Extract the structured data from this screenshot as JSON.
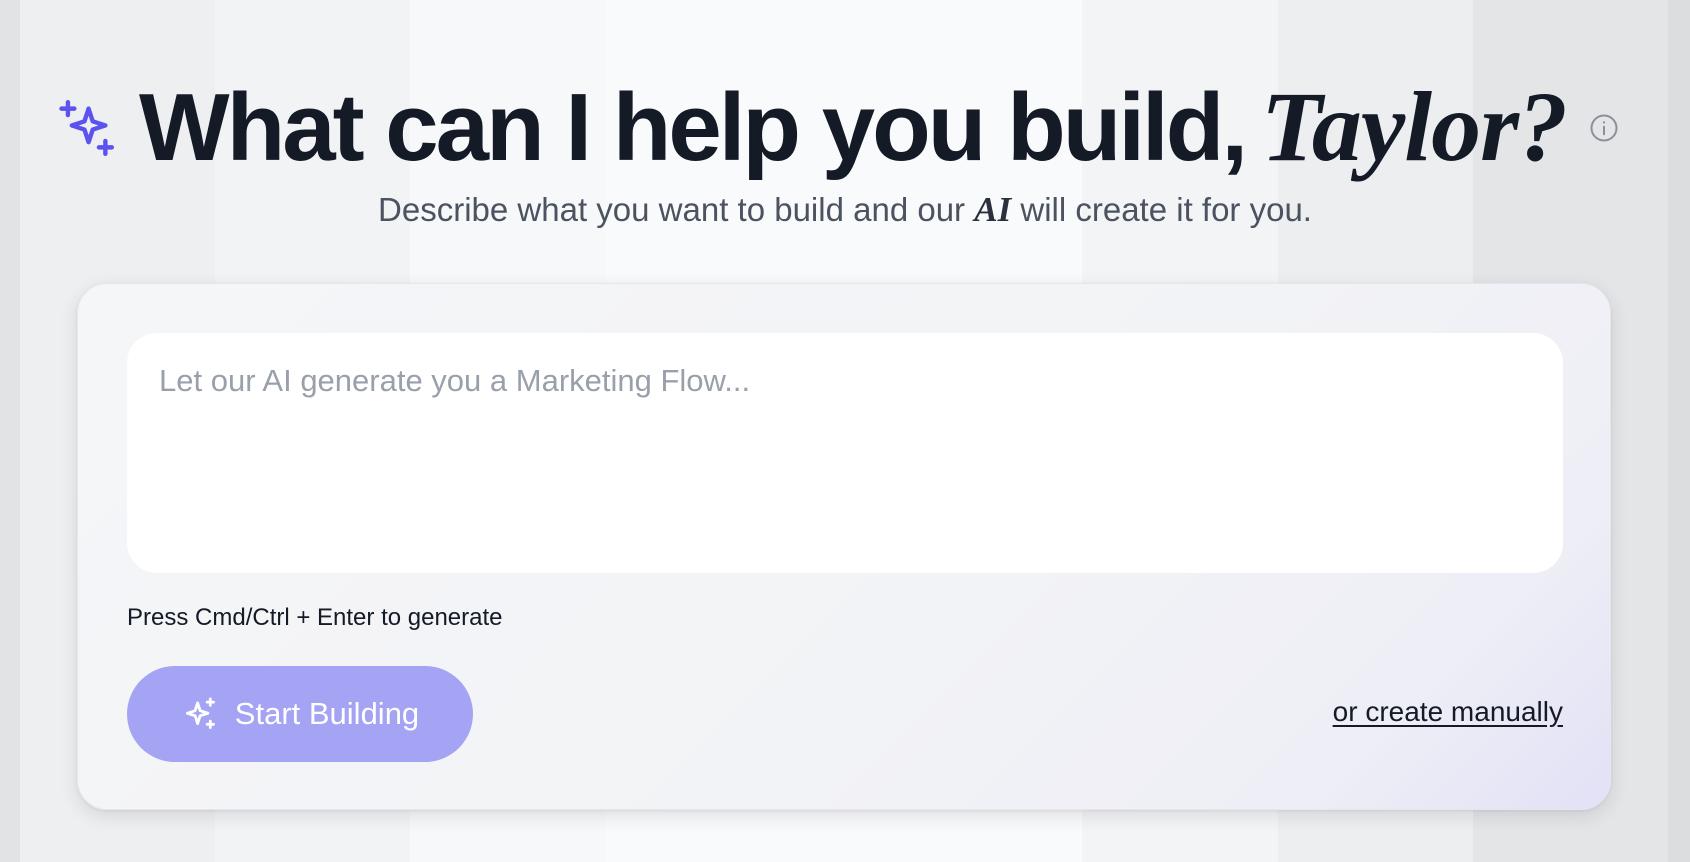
{
  "header": {
    "title": "What can I help you build,",
    "user_name": "Taylor?",
    "subtitle_before": "Describe what you want to build and our",
    "subtitle_ai": "AI",
    "subtitle_after": "will create it for you."
  },
  "prompt": {
    "value": "",
    "placeholder": "Let our AI generate you a Marketing Flow..."
  },
  "hint": "Press Cmd/Ctrl + Enter to generate",
  "actions": {
    "start_label": "Start Building",
    "manual_label": "or create manually"
  },
  "icons": {
    "title_icon": "sparkles-icon",
    "info": "info-icon",
    "button_icon": "sparkles-icon"
  },
  "colors": {
    "accent": "#5b52f0",
    "button": "#a5a3f4",
    "text": "#141a26"
  }
}
